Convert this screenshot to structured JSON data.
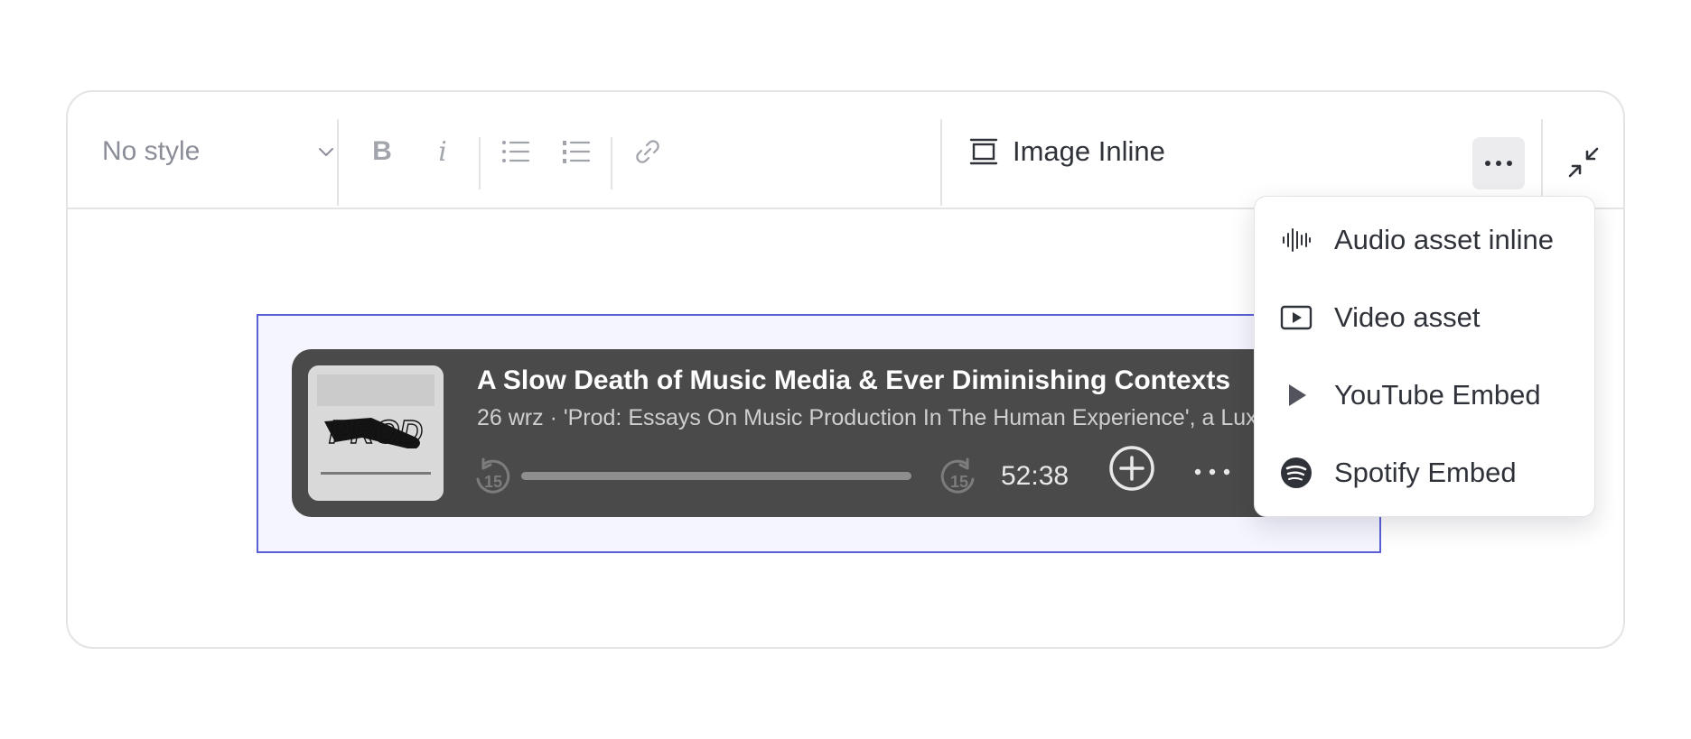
{
  "toolbar": {
    "style_select_value": "No style",
    "bold_label": "B",
    "italic_label": "i",
    "image_inline_label": "Image Inline"
  },
  "player": {
    "title": "A Slow Death of Music Media & Ever Diminishing Contexts",
    "subtitle": "26 wrz · 'Prod: Essays On Music Production In The Human Experience', a Lux",
    "cover_text": "PROD",
    "skip_back_label": "15",
    "skip_forward_label": "15",
    "duration": "52:38",
    "progress": 0
  },
  "menu": {
    "items": [
      {
        "label": "Audio asset inline",
        "icon": "audio-waveform-icon"
      },
      {
        "label": "Video asset",
        "icon": "video-play-icon"
      },
      {
        "label": "YouTube Embed",
        "icon": "play-triangle-icon"
      },
      {
        "label": "Spotify Embed",
        "icon": "spotify-icon"
      }
    ]
  },
  "colors": {
    "accent": "#5b5fd6",
    "selection_bg": "#f4f5fe",
    "player_bg": "#4a4a4a",
    "text_dark": "#30323a",
    "text_muted": "#8b8e98"
  }
}
